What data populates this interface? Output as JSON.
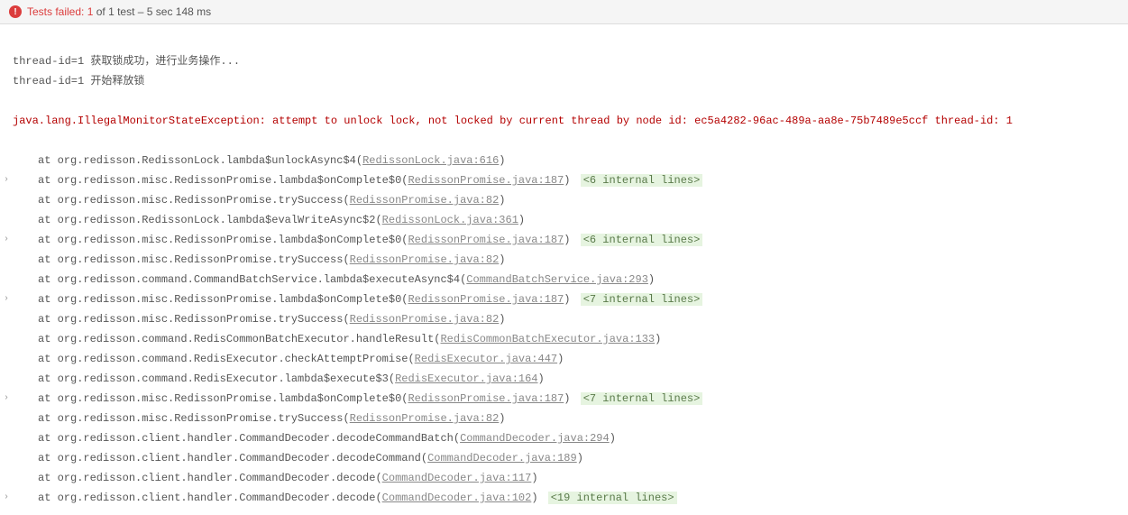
{
  "header": {
    "fail_label": "Tests failed:",
    "fail_count": "1",
    "of_text": " of 1 test",
    "dash": " – ",
    "duration": "5 sec 148 ms"
  },
  "output": {
    "log1": "thread-id=1 获取锁成功，进行业务操作...",
    "log2": "thread-id=1 开始释放锁",
    "exception": "java.lang.IllegalMonitorStateException: attempt to unlock lock, not locked by current thread by node id: ec5a4282-96ac-489a-aa8e-75b7489e5ccf thread-id: 1"
  },
  "stack": [
    {
      "expandable": false,
      "prefix": "at org.redisson.RedissonLock.lambda$unlockAsync$4(",
      "link": "RedissonLock.java:616",
      "suffix": ")",
      "internal": null
    },
    {
      "expandable": true,
      "prefix": "at org.redisson.misc.RedissonPromise.lambda$onComplete$0(",
      "link": "RedissonPromise.java:187",
      "suffix": ")",
      "internal": "<6 internal lines>"
    },
    {
      "expandable": false,
      "prefix": "at org.redisson.misc.RedissonPromise.trySuccess(",
      "link": "RedissonPromise.java:82",
      "suffix": ")",
      "internal": null
    },
    {
      "expandable": false,
      "prefix": "at org.redisson.RedissonLock.lambda$evalWriteAsync$2(",
      "link": "RedissonLock.java:361",
      "suffix": ")",
      "internal": null
    },
    {
      "expandable": true,
      "prefix": "at org.redisson.misc.RedissonPromise.lambda$onComplete$0(",
      "link": "RedissonPromise.java:187",
      "suffix": ")",
      "internal": "<6 internal lines>"
    },
    {
      "expandable": false,
      "prefix": "at org.redisson.misc.RedissonPromise.trySuccess(",
      "link": "RedissonPromise.java:82",
      "suffix": ")",
      "internal": null
    },
    {
      "expandable": false,
      "prefix": "at org.redisson.command.CommandBatchService.lambda$executeAsync$4(",
      "link": "CommandBatchService.java:293",
      "suffix": ")",
      "internal": null
    },
    {
      "expandable": true,
      "prefix": "at org.redisson.misc.RedissonPromise.lambda$onComplete$0(",
      "link": "RedissonPromise.java:187",
      "suffix": ")",
      "internal": "<7 internal lines>"
    },
    {
      "expandable": false,
      "prefix": "at org.redisson.misc.RedissonPromise.trySuccess(",
      "link": "RedissonPromise.java:82",
      "suffix": ")",
      "internal": null
    },
    {
      "expandable": false,
      "prefix": "at org.redisson.command.RedisCommonBatchExecutor.handleResult(",
      "link": "RedisCommonBatchExecutor.java:133",
      "suffix": ")",
      "internal": null
    },
    {
      "expandable": false,
      "prefix": "at org.redisson.command.RedisExecutor.checkAttemptPromise(",
      "link": "RedisExecutor.java:447",
      "suffix": ")",
      "internal": null
    },
    {
      "expandable": false,
      "prefix": "at org.redisson.command.RedisExecutor.lambda$execute$3(",
      "link": "RedisExecutor.java:164",
      "suffix": ")",
      "internal": null
    },
    {
      "expandable": true,
      "prefix": "at org.redisson.misc.RedissonPromise.lambda$onComplete$0(",
      "link": "RedissonPromise.java:187",
      "suffix": ")",
      "internal": "<7 internal lines>"
    },
    {
      "expandable": false,
      "prefix": "at org.redisson.misc.RedissonPromise.trySuccess(",
      "link": "RedissonPromise.java:82",
      "suffix": ")",
      "internal": null
    },
    {
      "expandable": false,
      "prefix": "at org.redisson.client.handler.CommandDecoder.decodeCommandBatch(",
      "link": "CommandDecoder.java:294",
      "suffix": ")",
      "internal": null
    },
    {
      "expandable": false,
      "prefix": "at org.redisson.client.handler.CommandDecoder.decodeCommand(",
      "link": "CommandDecoder.java:189",
      "suffix": ")",
      "internal": null
    },
    {
      "expandable": false,
      "prefix": "at org.redisson.client.handler.CommandDecoder.decode(",
      "link": "CommandDecoder.java:117",
      "suffix": ")",
      "internal": null
    },
    {
      "expandable": true,
      "prefix": "at org.redisson.client.handler.CommandDecoder.decode(",
      "link": "CommandDecoder.java:102",
      "suffix": ")",
      "internal": "<19 internal lines>"
    }
  ]
}
